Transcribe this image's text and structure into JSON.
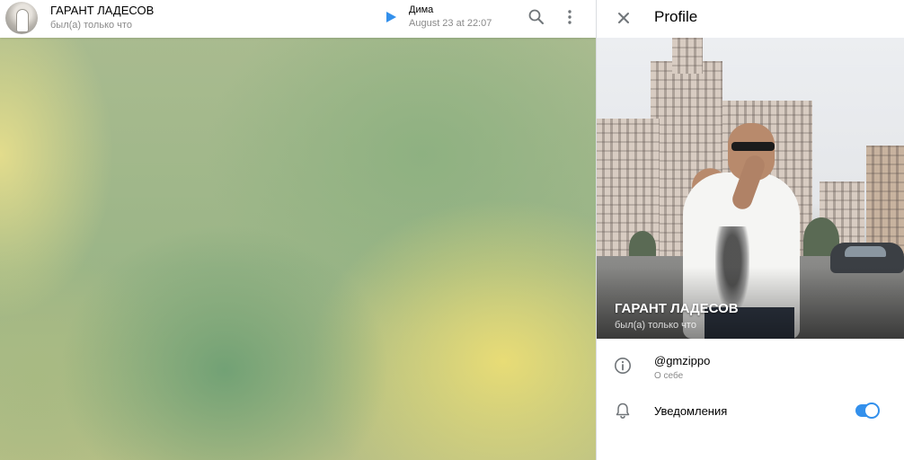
{
  "chat": {
    "name": "ГАРАНТ ЛАДЕСОВ",
    "status": "был(а) только что",
    "pinned_author": "Дима",
    "pinned_date": "August 23 at 22:07"
  },
  "profile": {
    "title": "Profile",
    "name": "ГАРАНТ ЛАДЕСОВ",
    "status": "был(а) только что",
    "username": "@gmzippo",
    "username_caption": "О себе",
    "notifications_label": "Уведомления",
    "notifications_on": true
  },
  "icons": {
    "close": "close-icon",
    "search": "search-icon",
    "more": "more-vertical-icon",
    "play": "play-icon",
    "info": "info-icon",
    "bell": "bell-icon"
  },
  "colors": {
    "accent": "#3390ec",
    "muted_text": "#8a8a8a"
  }
}
